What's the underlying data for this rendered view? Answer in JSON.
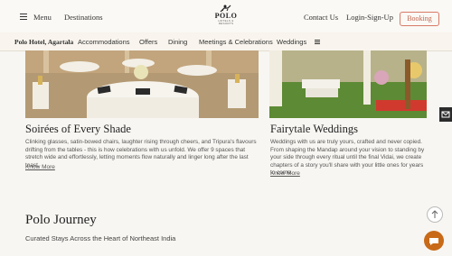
{
  "header": {
    "menu_label": "Menu",
    "destinations_label": "Destinations",
    "logo_text": "POLO",
    "logo_subtext": "HOTELS & RESORTS",
    "contact_label": "Contact Us",
    "login_label": "Login-Sign-Up",
    "booking_label": "Booking"
  },
  "subnav": {
    "hotel": "Polo Hotel, Agartala",
    "items": [
      "Accommodations",
      "Offers",
      "Dining",
      "Meetings & Celebrations",
      "Weddings"
    ]
  },
  "cards": [
    {
      "title": "Soirées of Every Shade",
      "body": "Clinking glasses, satin-bowed chairs, laughter rising through cheers, and Tripura's flavours drifting from the tables - this is how celebrations with us unfold. We offer 9 spaces that stretch wide and effortlessly, letting moments flow naturally and linger long after the last toast.",
      "link": "Know More"
    },
    {
      "title": "Fairytale Weddings",
      "body": "Weddings with us are truly yours, crafted and never copied. From shaping the Mandap around your vision to standing by your side through every ritual until the final Vidai, we create chapters of a story you'll share with your little ones for years to come.",
      "link": "Know More"
    }
  ],
  "journey": {
    "title": "Polo Journey",
    "subtitle": "Curated Stays Across the Heart of Northeast India"
  },
  "icons": [
    "menu-icon",
    "chevron-right-icon",
    "more-menu-icon",
    "mail-icon",
    "arrow-up-icon",
    "chat-icon"
  ],
  "colors": {
    "accent": "#c06652",
    "chat": "#c86a18"
  }
}
